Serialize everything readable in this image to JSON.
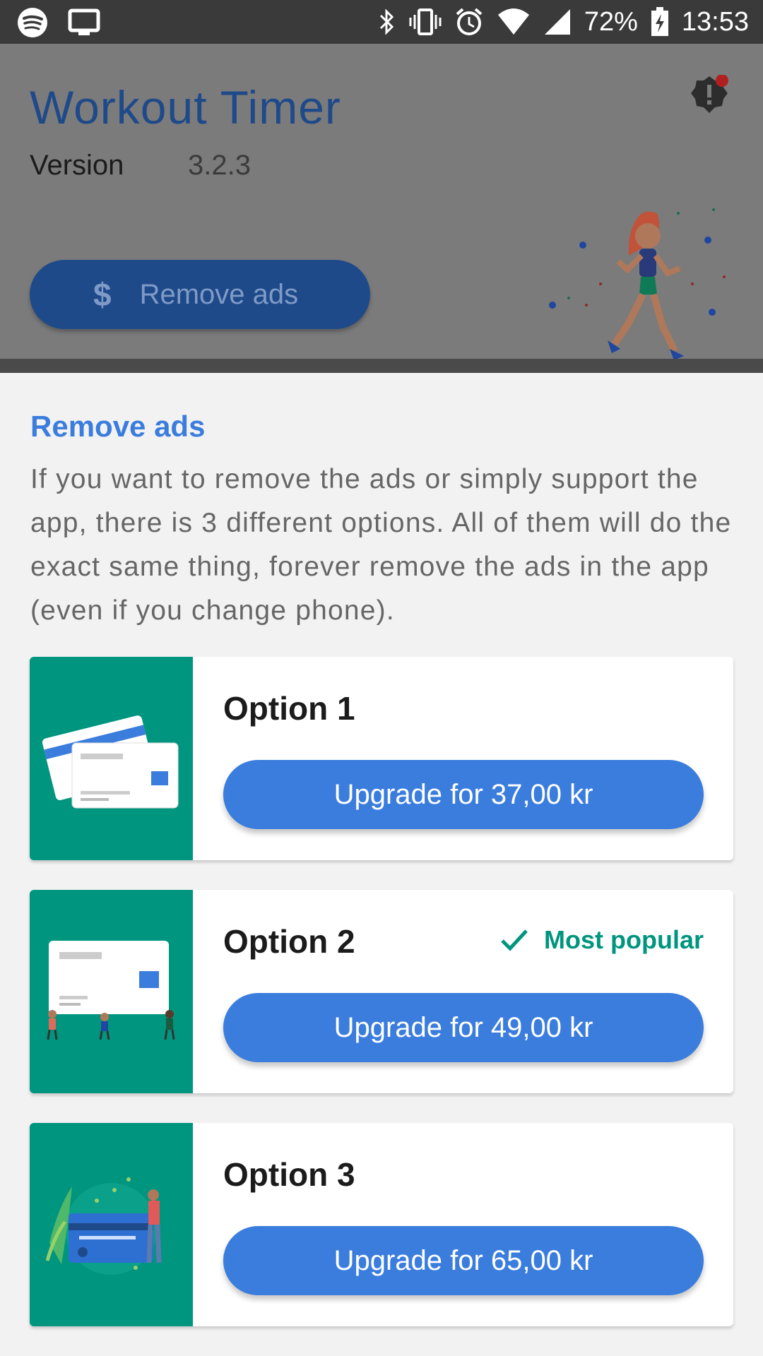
{
  "status_bar": {
    "battery": "72%",
    "time": "13:53"
  },
  "app": {
    "title": "Workout Timer",
    "version_label": "Version",
    "version_value": "3.2.3",
    "remove_ads_button": "Remove ads",
    "dollar_symbol": "$"
  },
  "sheet": {
    "title": "Remove ads",
    "description": "If you want to remove the ads or simply support the app, there is 3 different options. All of them will do the exact same thing, forever remove the ads in the app (even if you change phone).",
    "options": [
      {
        "title": "Option 1",
        "button": "Upgrade for 37,00 kr"
      },
      {
        "title": "Option 2",
        "button": "Upgrade for 49,00 kr",
        "badge": "Most popular"
      },
      {
        "title": "Option 3",
        "button": "Upgrade for 65,00 kr"
      }
    ]
  },
  "colors": {
    "accent": "#3b7ddd",
    "teal": "#00957f",
    "dark_blue": "#1f4a8a"
  }
}
